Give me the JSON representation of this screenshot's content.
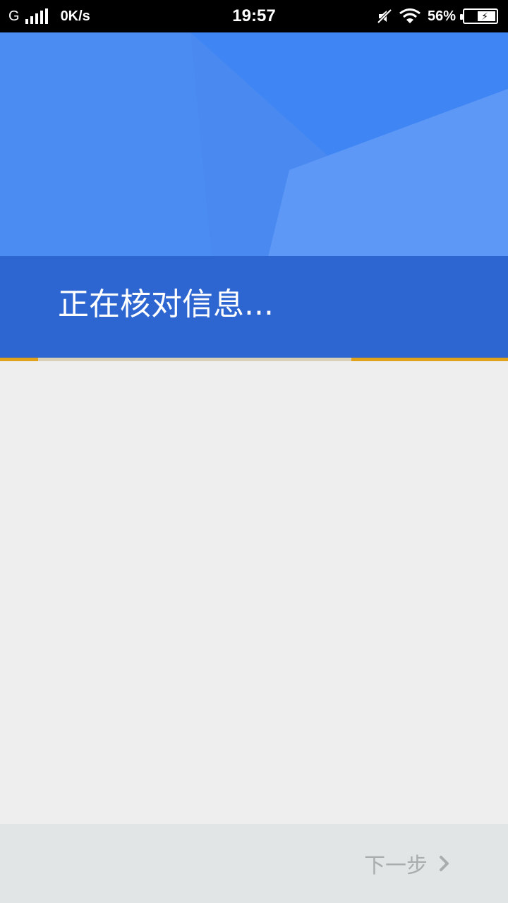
{
  "status_bar": {
    "network_type": "G",
    "speed": "0K/s",
    "time": "19:57",
    "battery_percent": "56%",
    "icons": [
      "signal-icon",
      "mute-icon",
      "wifi-icon",
      "battery-charging-icon"
    ]
  },
  "header": {
    "title": "正在核对信息...",
    "colors": {
      "background": "#4a8af0",
      "band": "#2e66d1",
      "accent": "#e1a21b"
    }
  },
  "progress": {
    "description": "indeterminate"
  },
  "footer": {
    "next_label": "下一步",
    "next_icon": "chevron-right-icon"
  }
}
